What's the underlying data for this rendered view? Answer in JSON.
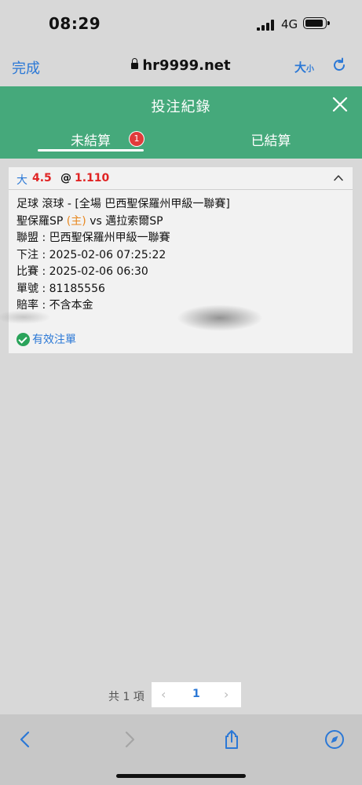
{
  "status_bar": {
    "time": "08:29",
    "network": "4G"
  },
  "browser": {
    "done_label": "完成",
    "url": "hr9999.net",
    "text_size_big": "大",
    "text_size_small": "小"
  },
  "header": {
    "title": "投注紀錄",
    "tabs": [
      {
        "label": "未結算",
        "badge": "1",
        "active": true
      },
      {
        "label": "已結算",
        "active": false
      }
    ]
  },
  "bet": {
    "type": "大",
    "line": "4.5",
    "at": "@",
    "odds": "1.110",
    "market": "足球 滾球 - [全場 巴西聖保羅州甲級一聯賽]",
    "home_team": "聖保羅SP",
    "home_tag": "(主)",
    "vs": "vs",
    "away_team": "邁拉索爾SP",
    "league_label": "聯盟",
    "league": "巴西聖保羅州甲級一聯賽",
    "placed_label": "下注",
    "placed_time": "2025-02-06 07:25:22",
    "match_label": "比賽",
    "match_time": "2025-02-06 06:30",
    "ticket_label": "單號",
    "ticket_no": "81185556",
    "odds_type_label": "賠率",
    "odds_type": "不含本金",
    "status": "有效注單"
  },
  "pagination": {
    "total": "共 1 項",
    "prev": "‹",
    "current": "1",
    "next": "›"
  },
  "colors": {
    "header_green": "#45a97b",
    "accent_blue": "#2b78d6",
    "odds_red": "#e02424",
    "home_orange": "#e8871e",
    "badge_red": "#e03b3b",
    "valid_green": "#2aa35a"
  },
  "icons": [
    "lock-icon",
    "reload-icon",
    "close-icon",
    "chevron-up-icon",
    "check-circle-icon",
    "back-icon",
    "forward-icon",
    "share-icon",
    "compass-icon"
  ]
}
